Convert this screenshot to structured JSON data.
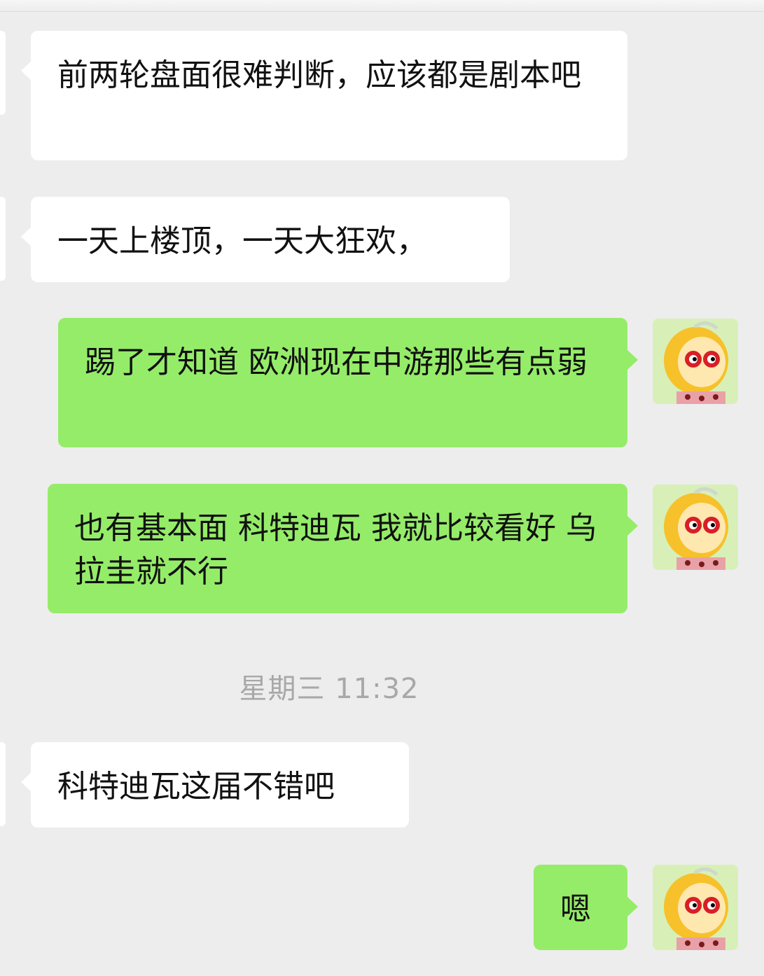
{
  "messages": [
    {
      "side": "left",
      "text": "前两轮盘面很难判断，应该都是剧本吧"
    },
    {
      "side": "left",
      "text": "一天上楼顶，一天大狂欢，"
    },
    {
      "side": "right",
      "text": "踢了才知道 欧洲现在中游那些有点弱"
    },
    {
      "side": "right",
      "text": "也有基本面 科特迪瓦 我就比较看好 乌拉圭就不行"
    },
    {
      "side": "left",
      "text": "科特迪瓦这届不错吧"
    },
    {
      "side": "right",
      "text": "嗯"
    }
  ],
  "timestamp": "星期三 11:32",
  "self_avatar_icon": "cartoon-monkey-avatar",
  "colors": {
    "background": "#ededed",
    "received_bubble": "#ffffff",
    "sent_bubble": "#95ec69",
    "timestamp_text": "#a8a8a8"
  }
}
